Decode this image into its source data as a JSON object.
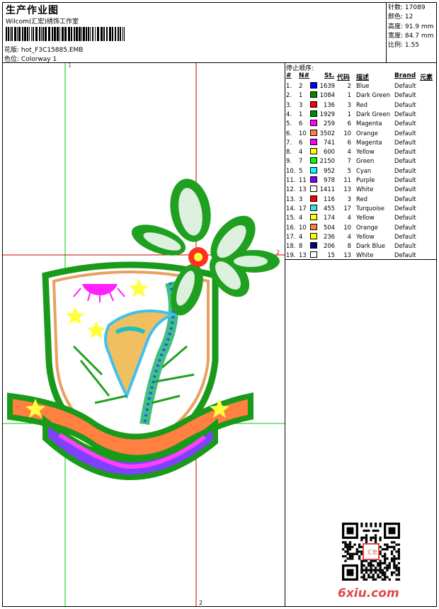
{
  "header": {
    "title": "生产作业图",
    "company": "Wilcom(汇宏)绣饰工作室",
    "filename_label": "花版:",
    "filename": "hot_F3C15885.EMB",
    "colorway_label": "色位:",
    "colorway": "Colorway 1"
  },
  "stats": {
    "stitches_label": "针数:",
    "stitches": "17089",
    "colors_label": "颜色:",
    "colors": "12",
    "height_label": "高度:",
    "height": "91.9 mm",
    "width_label": "宽度:",
    "width": "84.7 mm",
    "scale_label": "比例:",
    "scale": "1.55"
  },
  "stop_sequence": {
    "title": "停止顺序:",
    "headers": {
      "idx": "#",
      "n": "N#",
      "st": "St.",
      "code": "代码",
      "desc": "描述",
      "brand": "Brand",
      "elem": "元素"
    },
    "rows": [
      {
        "idx": "1.",
        "n": "2",
        "color": "#0000ff",
        "st": "1639",
        "code": "2",
        "desc": "Blue",
        "brand": "Default"
      },
      {
        "idx": "2.",
        "n": "1",
        "color": "#008800",
        "st": "1084",
        "code": "1",
        "desc": "Dark Green",
        "brand": "Default"
      },
      {
        "idx": "3.",
        "n": "3",
        "color": "#ff0000",
        "st": "136",
        "code": "3",
        "desc": "Red",
        "brand": "Default"
      },
      {
        "idx": "4.",
        "n": "1",
        "color": "#008800",
        "st": "1929",
        "code": "1",
        "desc": "Dark Green",
        "brand": "Default"
      },
      {
        "idx": "5.",
        "n": "6",
        "color": "#ff00ff",
        "st": "259",
        "code": "6",
        "desc": "Magenta",
        "brand": "Default"
      },
      {
        "idx": "6.",
        "n": "10",
        "color": "#ff8040",
        "st": "3502",
        "code": "10",
        "desc": "Orange",
        "brand": "Default"
      },
      {
        "idx": "7.",
        "n": "6",
        "color": "#ff00ff",
        "st": "741",
        "code": "6",
        "desc": "Magenta",
        "brand": "Default"
      },
      {
        "idx": "8.",
        "n": "4",
        "color": "#ffff00",
        "st": "600",
        "code": "4",
        "desc": "Yellow",
        "brand": "Default"
      },
      {
        "idx": "9.",
        "n": "7",
        "color": "#00ff00",
        "st": "2150",
        "code": "7",
        "desc": "Green",
        "brand": "Default"
      },
      {
        "idx": "10.",
        "n": "5",
        "color": "#00ffff",
        "st": "952",
        "code": "5",
        "desc": "Cyan",
        "brand": "Default"
      },
      {
        "idx": "11.",
        "n": "11",
        "color": "#8000ff",
        "st": "978",
        "code": "11",
        "desc": "Purple",
        "brand": "Default"
      },
      {
        "idx": "12.",
        "n": "13",
        "color": "#ffffff",
        "st": "1411",
        "code": "13",
        "desc": "White",
        "brand": "Default"
      },
      {
        "idx": "13.",
        "n": "3",
        "color": "#ff0000",
        "st": "116",
        "code": "3",
        "desc": "Red",
        "brand": "Default"
      },
      {
        "idx": "14.",
        "n": "17",
        "color": "#40e0d0",
        "st": "455",
        "code": "17",
        "desc": "Turquoise",
        "brand": "Default"
      },
      {
        "idx": "15.",
        "n": "4",
        "color": "#ffff00",
        "st": "174",
        "code": "4",
        "desc": "Yellow",
        "brand": "Default"
      },
      {
        "idx": "16.",
        "n": "10",
        "color": "#ff8040",
        "st": "504",
        "code": "10",
        "desc": "Orange",
        "brand": "Default"
      },
      {
        "idx": "17.",
        "n": "4",
        "color": "#ffff00",
        "st": "236",
        "code": "4",
        "desc": "Yellow",
        "brand": "Default"
      },
      {
        "idx": "18.",
        "n": "8",
        "color": "#000080",
        "st": "206",
        "code": "8",
        "desc": "Dark Blue",
        "brand": "Default"
      },
      {
        "idx": "19.",
        "n": "13",
        "color": "#ffffff",
        "st": "15",
        "code": "13",
        "desc": "White",
        "brand": "Default"
      }
    ]
  },
  "markers": {
    "top": "1",
    "right": "2",
    "bottom": "2"
  },
  "watermark": {
    "site": "6xiu.com",
    "stamp": "汇宏"
  }
}
